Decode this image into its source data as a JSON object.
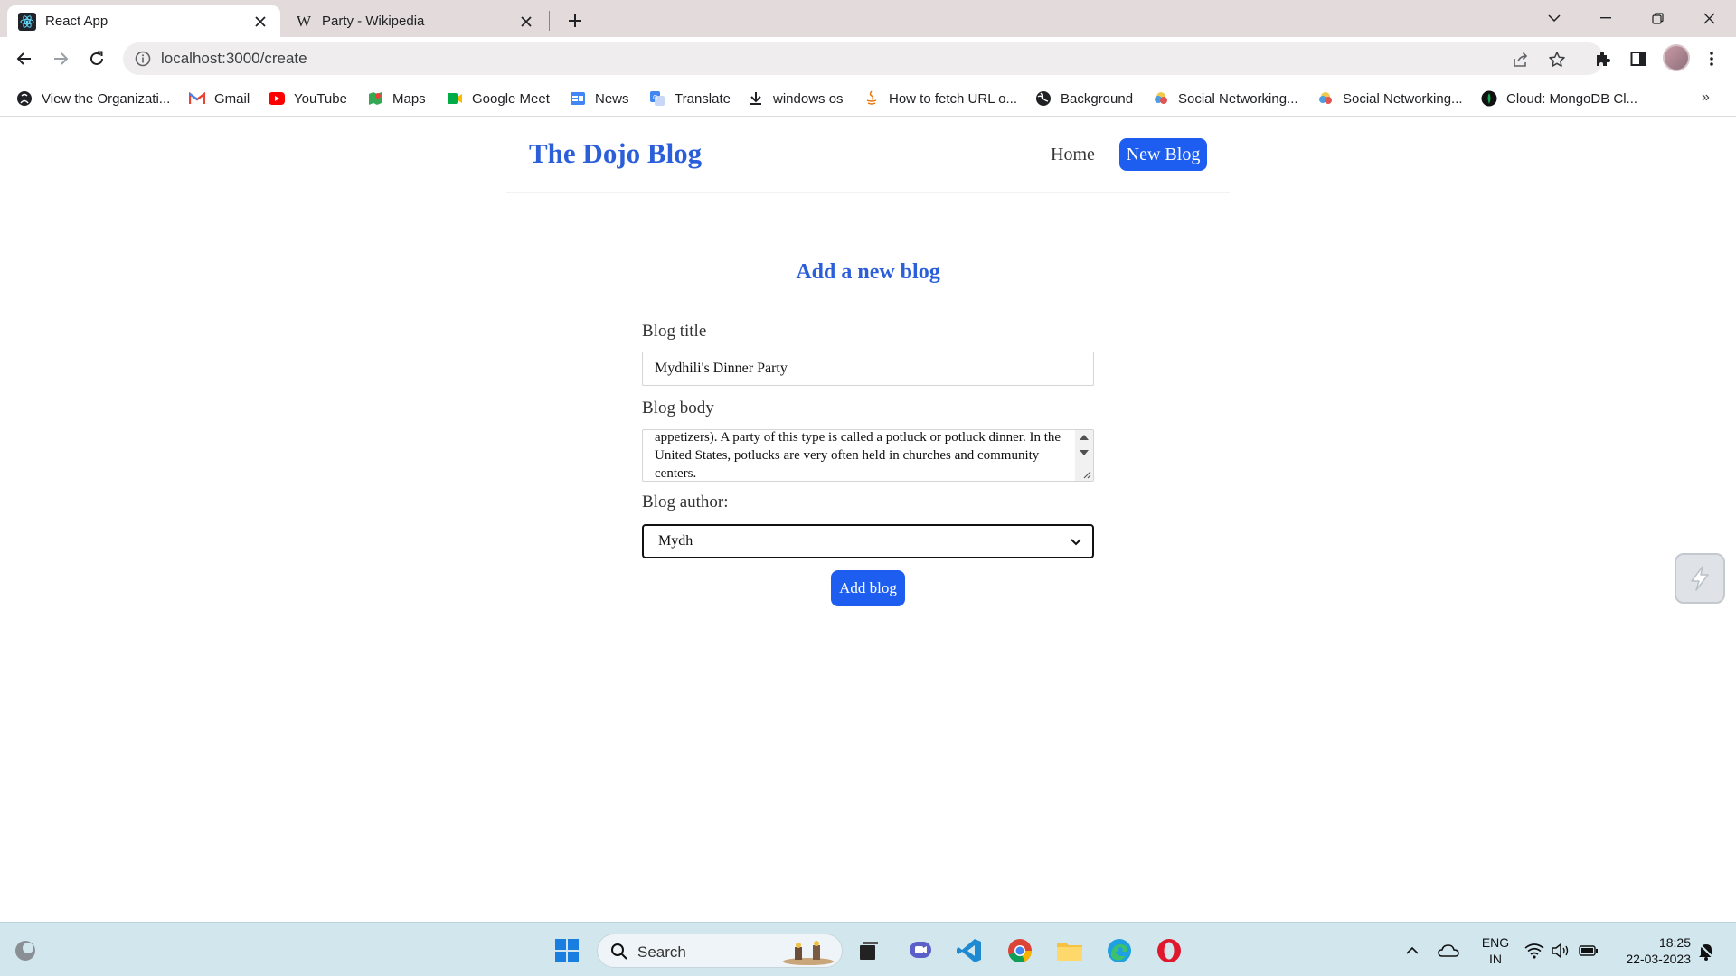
{
  "browser": {
    "tabs": [
      {
        "title": "React App",
        "active": true
      },
      {
        "title": "Party - Wikipedia",
        "active": false
      }
    ],
    "url": "localhost:3000/create",
    "bookmarks": [
      {
        "label": "View the Organizati...",
        "icon": "github-icon"
      },
      {
        "label": "Gmail",
        "icon": "gmail-icon"
      },
      {
        "label": "YouTube",
        "icon": "youtube-icon"
      },
      {
        "label": "Maps",
        "icon": "maps-icon"
      },
      {
        "label": "Google Meet",
        "icon": "meet-icon"
      },
      {
        "label": "News",
        "icon": "news-icon"
      },
      {
        "label": "Translate",
        "icon": "translate-icon"
      },
      {
        "label": "windows os",
        "icon": "download-icon"
      },
      {
        "label": "How to fetch URL o...",
        "icon": "java-icon"
      },
      {
        "label": "Background",
        "icon": "globe-icon"
      },
      {
        "label": "Social Networking...",
        "icon": "cloud-icon"
      },
      {
        "label": "Social Networking...",
        "icon": "cloud-icon"
      },
      {
        "label": "Cloud: MongoDB Cl...",
        "icon": "mongodb-icon"
      }
    ],
    "more_bookmarks": "»"
  },
  "app": {
    "brand": "The Dojo Blog",
    "nav": {
      "home": "Home",
      "new_blog": "New Blog"
    },
    "form": {
      "heading": "Add a new blog",
      "title_label": "Blog title",
      "title_value": "Mydhili's Dinner Party",
      "body_label": "Blog body",
      "body_value": "appetizers). A party of this type is called a potluck or potluck dinner. In the United States, potlucks are very often held in churches and community centers.",
      "author_label": "Blog author:",
      "author_value": "Mydh",
      "submit_label": "Add blog"
    },
    "accent_color": "#1d5df0"
  },
  "taskbar": {
    "search_label": "Search",
    "lang_top": "ENG",
    "lang_bottom": "IN",
    "time": "18:25",
    "date": "22-03-2023"
  }
}
